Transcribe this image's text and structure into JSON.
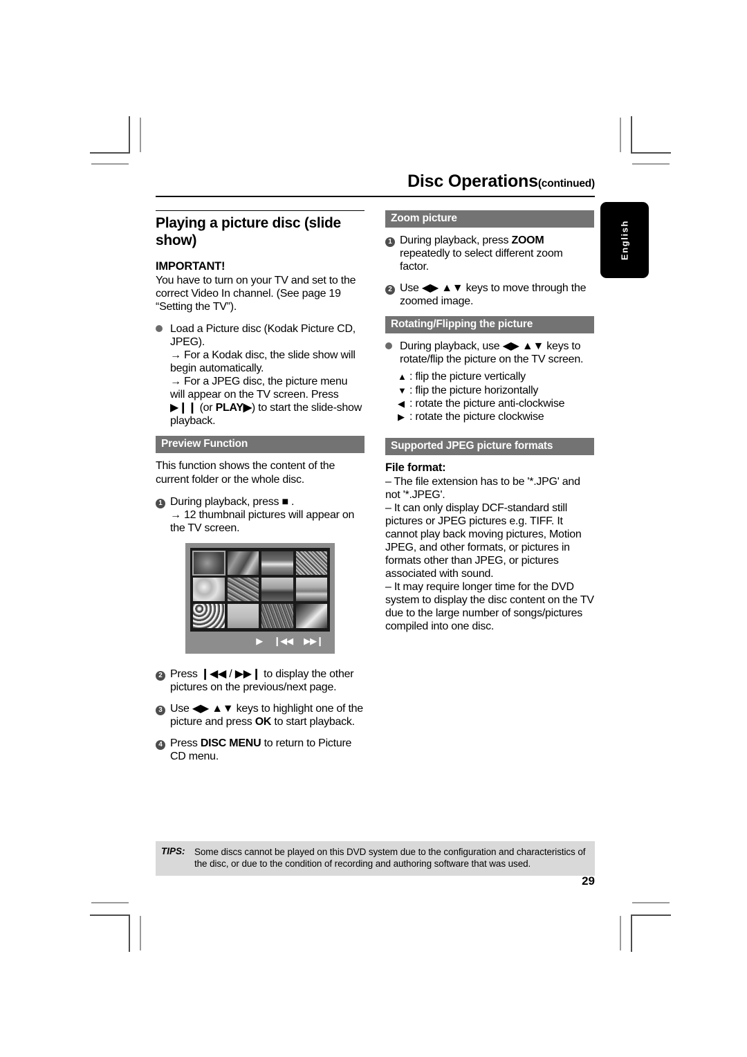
{
  "running_head": {
    "title": "Disc Operations",
    "continued": "(continued)"
  },
  "language_tab": {
    "label": "English"
  },
  "left_column": {
    "section_title": "Playing a picture disc (slide show)",
    "important_label": "IMPORTANT!",
    "important_text": "You have to turn on your TV and set to the correct Video In channel.  (See page 19 “Setting the TV”).",
    "load_disc": {
      "marker": "bullet",
      "text": "Load a Picture disc (Kodak Picture CD, JPEG).",
      "sub1": "→ For a Kodak disc, the slide show will begin automatically.",
      "sub2_a": "→ For a JPEG disc, the picture menu will appear on the TV screen.  Press ",
      "sub2_icon": "▶❙❙",
      "sub2_b": " (or ",
      "sub2_bold": "PLAY",
      "sub2_bold_icon": "▶",
      "sub2_c": ") to start the slide-show playback."
    },
    "preview": {
      "heading": "Preview Function",
      "intro": "This function shows the content of the current folder or the whole disc.",
      "step1_a": "During playback, press ",
      "step1_icon": "■",
      "step1_b": " .",
      "step1_sub": "→ 12 thumbnail pictures will appear on the TV screen."
    },
    "screenshot": {
      "name": "picture-cd-thumbnail-menu",
      "thumbnail_count": 12,
      "selected_index": 1,
      "nav_icons": [
        "play-icon",
        "previous-icon",
        "next-icon"
      ],
      "nav_glyphs": [
        "▶",
        "❙◀◀",
        "▶▶❙"
      ]
    },
    "step2": {
      "number": "2",
      "a": "Press ",
      "icon_prev": "❙◀◀",
      "mid": " / ",
      "icon_next": "▶▶❙",
      "b": " to display the other pictures on the previous/next page."
    },
    "step3": {
      "number": "3",
      "a": "Use ",
      "keys": "◀▶ ▲▼",
      "b": " keys to highlight one of the picture and press ",
      "bold": "OK",
      "c": " to start playback."
    },
    "step4": {
      "number": "4",
      "a": "Press ",
      "bold": "DISC MENU",
      "b": " to return to Picture CD menu."
    }
  },
  "right_column": {
    "zoom": {
      "heading": "Zoom picture",
      "step1": {
        "number": "1",
        "a": "During playback, press ",
        "bold": "ZOOM",
        "b": " repeatedly to select different zoom factor."
      },
      "step2": {
        "number": "2",
        "a": "Use ",
        "keys": "◀▶ ▲▼",
        "b": " keys to move through the zoomed image."
      }
    },
    "rotate": {
      "heading": "Rotating/Flipping the picture",
      "bullet_a": "During playback, use ",
      "bullet_keys": "◀▶ ▲▼",
      "bullet_b": " keys to rotate/flip the picture on the TV screen.",
      "legend": [
        {
          "symbol": "▲",
          "text": ": flip the picture vertically"
        },
        {
          "symbol": "▼",
          "text": ": flip the picture horizontally"
        },
        {
          "symbol": "◀",
          "text": ": rotate the picture anti-clockwise"
        },
        {
          "symbol": "▶",
          "text": ": rotate the picture clockwise"
        }
      ]
    },
    "formats": {
      "heading": "Supported JPEG picture formats",
      "subheading": "File format:",
      "dash1": "–  The file extension has to be '*.JPG' and not '*.JPEG'.",
      "dash2": "–  It can only display DCF-standard still pictures or JPEG pictures e.g. TIFF.  It cannot play back moving pictures, Motion JPEG, and other formats, or pictures in formats other than JPEG, or pictures associated with sound.",
      "dash3": "–  It may require longer time for the DVD system to display the disc content on the TV due to the large number of songs/pictures compiled into one disc."
    }
  },
  "footer": {
    "tips_label": "TIPS:",
    "tips_text": "Some discs cannot be played on this DVD system due to the configuration and characteristics of the disc, or due to the condition of recording and authoring software that was used.",
    "page_number": "29"
  },
  "colors": {
    "bar_gray": "#737373",
    "tips_gray": "#d9d9d9",
    "tab_black": "#000000",
    "marker_gray": "#4d4d4d"
  }
}
